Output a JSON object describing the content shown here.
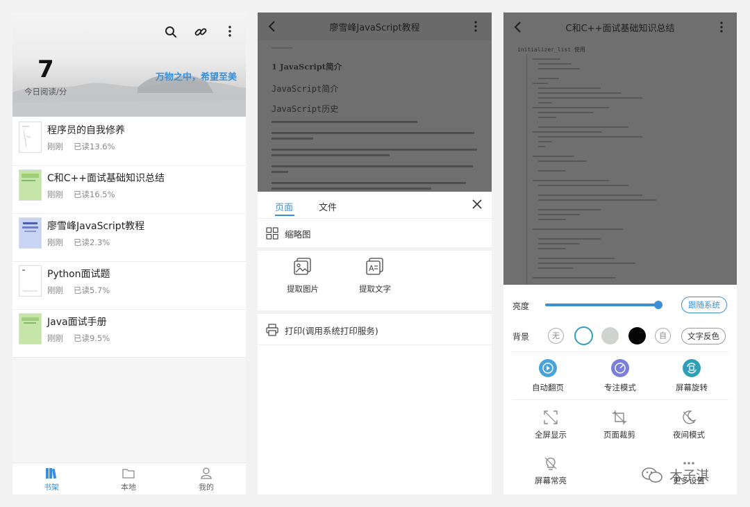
{
  "bookshelf": {
    "reading_minutes": "7",
    "reading_label": "今日阅读/分",
    "slogan": "万物之中，希望至美",
    "books": [
      {
        "title": "程序员的自我修养",
        "time": "刚刚",
        "progress": "已读13.6%"
      },
      {
        "title": "C和C++面试基础知识总结",
        "time": "刚刚",
        "progress": "已读16.5%"
      },
      {
        "title": "廖雪峰JavaScript教程",
        "time": "刚刚",
        "progress": "已读2.3%"
      },
      {
        "title": "Python面试题",
        "time": "刚刚",
        "progress": "已读5.7%"
      },
      {
        "title": "Java面试手册",
        "time": "刚刚",
        "progress": "已读9.5%"
      }
    ],
    "nav": {
      "shelf": "书架",
      "local": "本地",
      "mine": "我的"
    }
  },
  "reader_js": {
    "title": "廖雪峰JavaScript教程",
    "doc": {
      "h1": "1 JavaScript简介",
      "h2a": "JavaScript简介",
      "h2b": "JavaScript历史"
    },
    "menu": {
      "tab_page": "页面",
      "tab_file": "文件",
      "thumbnail": "缩略图",
      "extract_image": "提取图片",
      "extract_text": "提取文字",
      "print": "打印(调用系统打印服务)"
    }
  },
  "reader_cpp": {
    "title": "C和C++面试基础知识总结",
    "code_heading": "initializer_list 使用",
    "brightness_label": "亮度",
    "brightness_level": 0.98,
    "follow_system": "跟随系统",
    "background_label": "背景",
    "bg_none": "无",
    "bg_custom": "自",
    "invert_text": "文字反色",
    "features": [
      "自动翻页",
      "专注模式",
      "屏幕旋转",
      "全屏显示",
      "页面裁剪",
      "夜间模式",
      "屏幕常亮",
      "更多设置"
    ],
    "watermark": "木子淇"
  },
  "colors": {
    "accent": "#3b8fd6",
    "feature_blue": "#4aa3d8",
    "feature_purple": "#7b7fd8",
    "feature_teal": "#2f9fb8",
    "bg_gray": "#d0d4d1"
  }
}
